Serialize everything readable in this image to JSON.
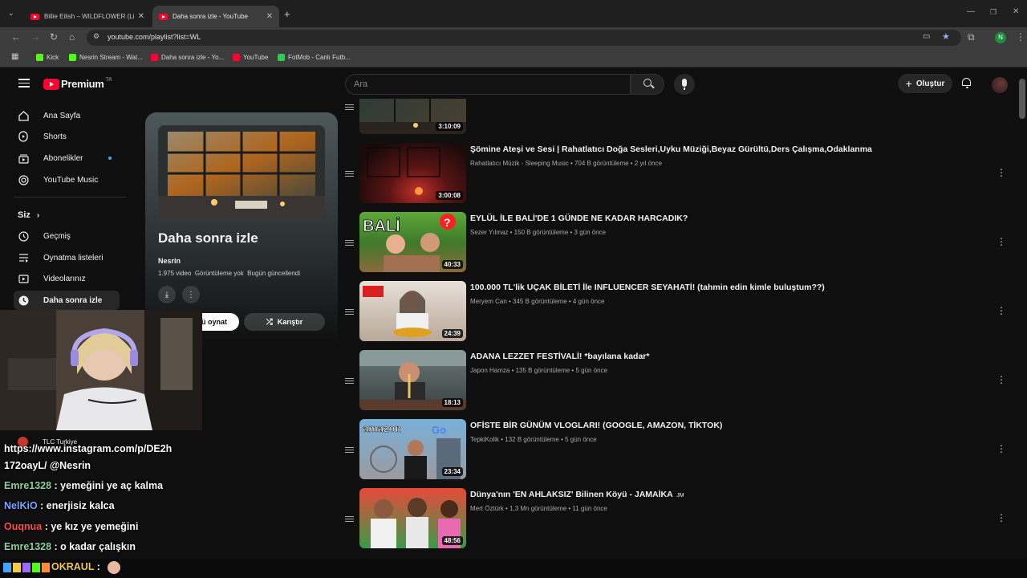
{
  "browser": {
    "tabs": [
      {
        "title": "Billie Eilish – WILDFLOWER (Liv",
        "active": false
      },
      {
        "title": "Daha sonra izle - YouTube",
        "active": true
      }
    ],
    "new_tab": "+",
    "url": "youtube.com/playlist?list=WL",
    "bookmarks": [
      {
        "label": "Kick",
        "color": "#53fc18"
      },
      {
        "label": "Nesrin Stream - Wat...",
        "color": "#53fc18"
      },
      {
        "label": "Daha sonra izle - Yo...",
        "color": "#ff0033"
      },
      {
        "label": "YouTube",
        "color": "#ff0033"
      },
      {
        "label": "FotMob - Canlı Futb...",
        "color": "#34c759"
      }
    ],
    "profile_initial": "N"
  },
  "header": {
    "logo": "Premium",
    "region": "TR",
    "search_placeholder": "Ara",
    "create_label": "Oluştur"
  },
  "sidebar": {
    "items": [
      {
        "label": "Ana Sayfa",
        "icon": "home-icon"
      },
      {
        "label": "Shorts",
        "icon": "shorts-icon"
      },
      {
        "label": "Abonelikler",
        "icon": "subscriptions-icon"
      },
      {
        "label": "YouTube Music",
        "icon": "music-icon"
      }
    ],
    "you_section": "Siz",
    "you_items": [
      {
        "label": "Geçmiş",
        "icon": "history-icon"
      },
      {
        "label": "Oynatma listeleri",
        "icon": "playlists-icon"
      },
      {
        "label": "Videolarınız",
        "icon": "videos-icon"
      },
      {
        "label": "Daha sonra izle",
        "icon": "watch-later-icon",
        "selected": true
      }
    ],
    "subscription_partial": "TLC Turkiye"
  },
  "playlist": {
    "title": "Daha sonra izle",
    "owner": "Nesrin",
    "stats": "1.975 video  Görüntüleme yok  Bugün güncellendi",
    "play_all": "Tümünü oynat",
    "play_all_visible": "ü oynat",
    "shuffle": "Karıştır"
  },
  "videos": [
    {
      "title": "",
      "channel": "",
      "meta": "",
      "duration": "3:10:09",
      "partial": true
    },
    {
      "title": "Şömine Ateşi ve Sesi | Rahatlatıcı Doğa Sesleri,Uyku Müziği,Beyaz Gürültü,Ders Çalışma,Odaklanma",
      "meta": "Rahatlatıcı Müzik - Sleeping Music • 704 B görüntüleme • 2 yıl önce",
      "duration": "3:00:08"
    },
    {
      "title": "EYLÜL İLE BALİ'DE 1 GÜNDE NE KADAR HARCADIK?",
      "meta": "Sezer Yılmaz • 150 B görüntüleme • 3 gün önce",
      "duration": "40:33"
    },
    {
      "title": "100.000 TL'lik UÇAK BİLETİ İle INFLUENCER SEYAHATİ! (tahmin edin kimle buluştum??)",
      "meta": "Meryem Can • 345 B görüntüleme • 4 gün önce",
      "duration": "24:39"
    },
    {
      "title": "ADANA LEZZET FESTİVALİ! *bayılana kadar*",
      "meta": "Japon Hamza • 135 B görüntüleme • 5 gün önce",
      "duration": "18:13"
    },
    {
      "title": "OFİSTE BİR GÜNÜM VLOGLARI! (GOOGLE, AMAZON, TİKTOK)",
      "meta": "TepkiKolik • 132 B görüntüleme • 5 gün önce",
      "duration": "23:34"
    },
    {
      "title": "Dünya'nın 'EN AHLAKSIZ' Bilinen Köyü - JAMAİKA",
      "title_suffix": "JM",
      "meta": "Mert Öztürk • 1,3 Mn görüntüleme • 11 gün önce",
      "duration": "48:56"
    }
  ],
  "chat": [
    {
      "user": "",
      "text": "https://www.instagram.com/p/DE2h",
      "color": "#ffffff"
    },
    {
      "user": "",
      "text": "172oayL/ @Nesrin",
      "color": "#ffffff"
    },
    {
      "user": "Emre1328",
      "text": " : yemeğini ye aç kalma",
      "color": "#8fd19e"
    },
    {
      "user": "NelKiO",
      "text": " : enerjisiz kalca",
      "color": "#7aa7ff"
    },
    {
      "user": "Ouqnua",
      "text": " : ye kız ye yemeğini",
      "color": "#ff4d4d"
    },
    {
      "user": "Emre1328",
      "text": " : o kadar çalışkın",
      "color": "#8fd19e"
    }
  ],
  "bottom_chat": {
    "user": "OKRAUL",
    "sep": " :",
    "color": "#f6c94a"
  }
}
